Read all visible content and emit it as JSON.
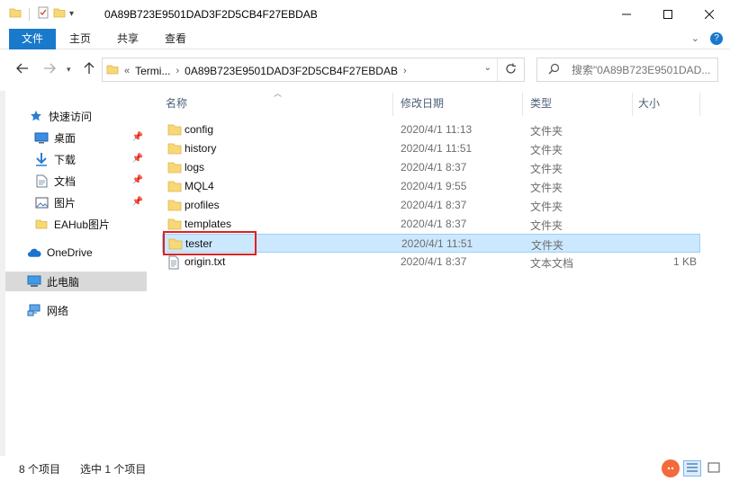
{
  "window": {
    "title": "0A89B723E9501DAD3F2D5CB4F27EBDAB",
    "minimize_icon": "minimize-icon",
    "maximize_icon": "maximize-icon",
    "close_icon": "close-icon"
  },
  "ribbon": {
    "tabs": [
      "文件",
      "主页",
      "共享",
      "查看"
    ]
  },
  "address": {
    "crumbs": [
      "Termi...",
      "0A89B723E9501DAD3F2D5CB4F27EBDAB"
    ],
    "overflow": "«",
    "search_placeholder": "搜索\"0A89B723E9501DAD..."
  },
  "nav": {
    "items": [
      {
        "label": "快速访问",
        "icon": "star-icon"
      },
      {
        "label": "桌面",
        "icon": "desktop-icon",
        "pinned": true
      },
      {
        "label": "下载",
        "icon": "download-icon",
        "pinned": true
      },
      {
        "label": "文档",
        "icon": "document-icon",
        "pinned": true
      },
      {
        "label": "图片",
        "icon": "pictures-icon",
        "pinned": true
      },
      {
        "label": "EAHub图片",
        "icon": "folder-icon"
      },
      {
        "label": "OneDrive",
        "icon": "cloud-icon"
      },
      {
        "label": "此电脑",
        "icon": "computer-icon",
        "selected": true
      },
      {
        "label": "网络",
        "icon": "network-icon"
      }
    ]
  },
  "columns": {
    "name": "名称",
    "date": "修改日期",
    "type": "类型",
    "size": "大小"
  },
  "files": [
    {
      "name": "config",
      "date": "2020/4/1 11:13",
      "type": "文件夹",
      "size": "",
      "icon": "folder-icon"
    },
    {
      "name": "history",
      "date": "2020/4/1 11:51",
      "type": "文件夹",
      "size": "",
      "icon": "folder-icon"
    },
    {
      "name": "logs",
      "date": "2020/4/1 8:37",
      "type": "文件夹",
      "size": "",
      "icon": "folder-icon"
    },
    {
      "name": "MQL4",
      "date": "2020/4/1 9:55",
      "type": "文件夹",
      "size": "",
      "icon": "folder-icon"
    },
    {
      "name": "profiles",
      "date": "2020/4/1 8:37",
      "type": "文件夹",
      "size": "",
      "icon": "folder-icon"
    },
    {
      "name": "templates",
      "date": "2020/4/1 8:37",
      "type": "文件夹",
      "size": "",
      "icon": "folder-icon"
    },
    {
      "name": "tester",
      "date": "2020/4/1 11:51",
      "type": "文件夹",
      "size": "",
      "icon": "folder-icon",
      "selected": true
    },
    {
      "name": "origin.txt",
      "date": "2020/4/1 8:37",
      "type": "文本文档",
      "size": "1 KB",
      "icon": "text-file-icon"
    }
  ],
  "status": {
    "item_count": "8 个项目",
    "selected_count": "选中 1 个项目"
  },
  "colors": {
    "accent": "#1979ca",
    "selection": "#cce8ff",
    "folder": "#f8d775",
    "highlight": "#e02020"
  }
}
